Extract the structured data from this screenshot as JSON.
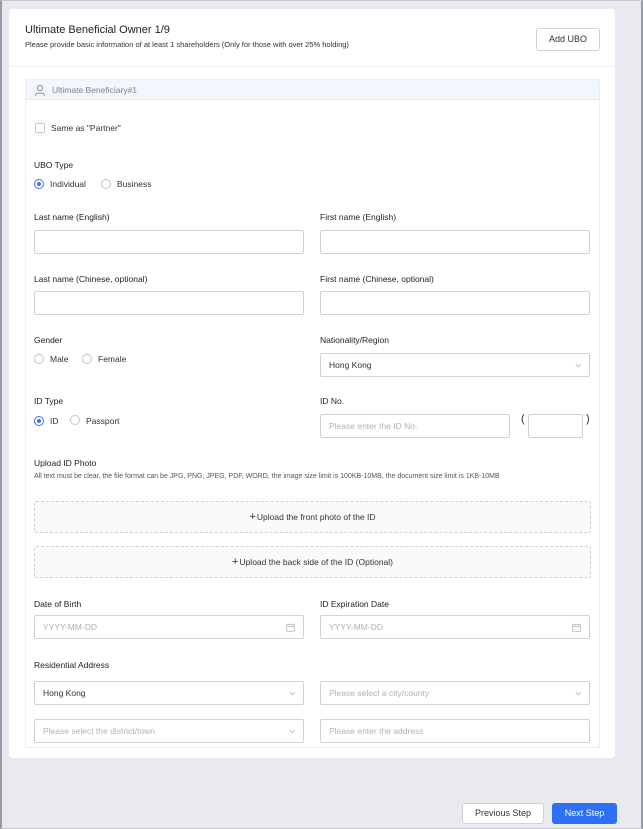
{
  "header": {
    "title": "Ultimate Beneficial Owner 1/9",
    "subtitle": "Please provide basic information of at least 1 shareholders (Only for those with over 25% holding)",
    "add_button": "Add UBO"
  },
  "section": {
    "title": "Ultimate Beneficiary#1",
    "same_as_partner": "Same as \"Partner\""
  },
  "ubo_type": {
    "label": "UBO Type",
    "options": [
      "Individual",
      "Business"
    ],
    "selected": "Individual"
  },
  "fields": {
    "last_name_en": "Last name (English)",
    "first_name_en": "First name (English)",
    "last_name_cn": "Last name (Chinese, optional)",
    "first_name_cn": "First name (Chinese, optional)"
  },
  "gender": {
    "label": "Gender",
    "options": [
      "Male",
      "Female"
    ]
  },
  "nationality": {
    "label": "Nationality/Region",
    "value": "Hong Kong"
  },
  "id_type": {
    "label": "ID Type",
    "options": [
      "ID",
      "Passport"
    ],
    "selected": "ID"
  },
  "id_no": {
    "label": "ID No.",
    "placeholder": "Please enter the ID No.",
    "open_paren": "(",
    "close_paren": ")"
  },
  "upload": {
    "label": "Upload ID Photo",
    "hint": "All text must be clear, the file format can be JPG, PNG, JPEG, PDF, WORD, the image size limit is 100KB-10MB, the document size limit is 1KB-10MB",
    "plus": "+",
    "front": "Upload the front photo of the ID",
    "back": "Upload the back side of the ID (Optional)"
  },
  "dob": {
    "label": "Date of Birth",
    "placeholder": "YYYY-MM-DD"
  },
  "id_expiry": {
    "label": "ID Expiration Date",
    "placeholder": "YYYY-MM-DD"
  },
  "address": {
    "label": "Residential Address",
    "region": "Hong Kong",
    "city_placeholder": "Please select a city/county",
    "district_placeholder": "Please select the district/town",
    "address_placeholder": "Please enter the address"
  },
  "footer": {
    "previous": "Previous Step",
    "next": "Next Step"
  },
  "colors": {
    "accent": "#2f6ff5",
    "background": "#e8eaef",
    "section_header": "#f2f6fd"
  }
}
